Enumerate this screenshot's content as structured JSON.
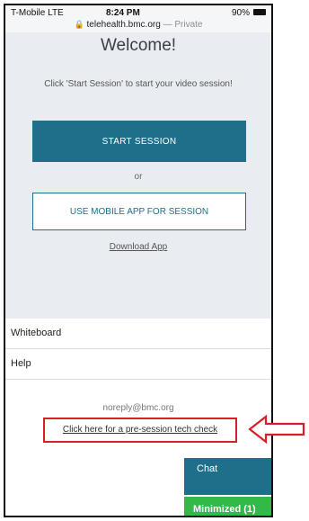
{
  "status_bar": {
    "carrier": "T-Mobile LTE",
    "time": "8:24 PM",
    "battery": "90%",
    "url": "telehealth.bmc.org",
    "private_label": "— Private"
  },
  "session": {
    "title": "Welcome!",
    "subtitle": "Click 'Start Session' to start your video session!",
    "start_button": "START SESSION",
    "or_text": "or",
    "mobile_app_button": "USE MOBILE APP FOR SESSION",
    "download_link": "Download App"
  },
  "menu": {
    "items": [
      "Whiteboard",
      "Help"
    ]
  },
  "footer": {
    "email": "noreply@bmc.org",
    "tech_check_link": "Click here for a pre-session tech check"
  },
  "widgets": {
    "chat_label": "Chat",
    "minimized_label": "Minimized (1)"
  },
  "colors": {
    "primary": "#1f6f8b",
    "highlight": "#d91f26",
    "minimized": "#33b84a"
  }
}
